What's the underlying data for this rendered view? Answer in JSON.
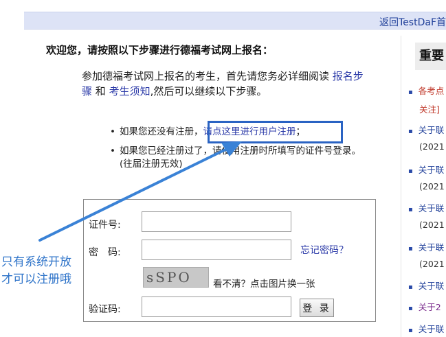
{
  "topbar": {
    "return_link": "返回TestDaF首"
  },
  "welcome": "欢迎您，请按照以下步骤进行德福考试网上报名：",
  "intro": {
    "part1": "参加德福考试网上报名的考生，首先请您务必详细阅读 ",
    "link_steps": "报名步骤",
    "and": " 和 ",
    "link_notice": "考生须知",
    "part2": ",然后可以继续以下步骤。"
  },
  "bullets": {
    "b1_prefix": "如果您还没有注册，",
    "b1_link": "请点这里进行用户注册",
    "b1_suffix": "；",
    "b2": "如果您已经注册过了，请使用注册时所填写的证件号登录。(往届注册无效)"
  },
  "login": {
    "id_label": "证件号:",
    "password_label": "密　码:",
    "forgot_link": "忘记密码？",
    "captcha_text": "sSPO",
    "captcha_hint": "看不清？点击图片换一张",
    "verify_label": "验证码:",
    "login_button": "登 录"
  },
  "annotation": {
    "line1": "只有系统开放",
    "line2": "才可以注册哦"
  },
  "sidebar": {
    "title": "重要",
    "items": [
      {
        "text": "各考点",
        "sub": "关注]",
        "style": "red"
      },
      {
        "text": "关于联",
        "sub": "(2021",
        "style": "blue"
      },
      {
        "text": "关于联",
        "sub": "(2021",
        "style": "blue"
      },
      {
        "text": "关于联",
        "sub": "(2021",
        "style": "blue"
      },
      {
        "text": "关于联",
        "sub": "(2021",
        "style": "blue"
      },
      {
        "text": "关于联",
        "sub": "",
        "style": "blue"
      },
      {
        "text": "关于2",
        "sub": "",
        "style": "purple"
      },
      {
        "text": "关于联",
        "sub": "",
        "style": "blue"
      }
    ]
  },
  "colors": {
    "link": "#2b3aa8",
    "highlight": "#2a63c3",
    "annotation": "#2f74c9",
    "alert": "#c0392b"
  }
}
